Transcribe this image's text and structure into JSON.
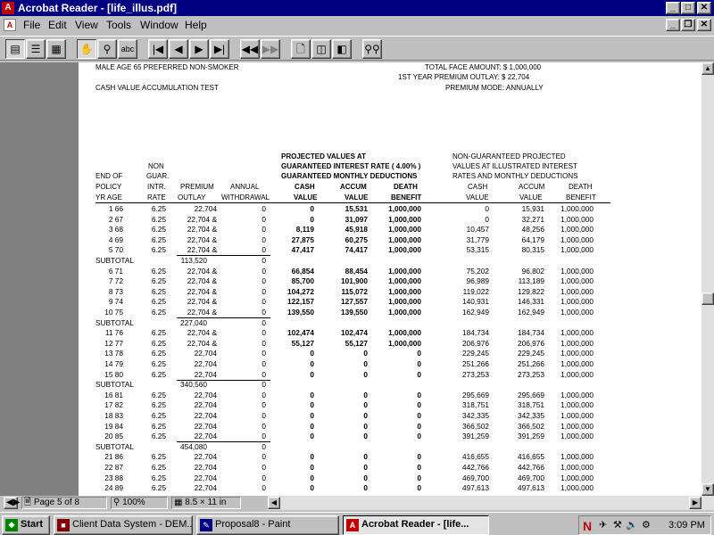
{
  "window": {
    "title": "Acrobat Reader - [life_illus.pdf]",
    "caption_buttons": [
      "_",
      "□",
      "✕"
    ]
  },
  "menu": [
    "File",
    "Edit",
    "View",
    "Tools",
    "Window",
    "Help"
  ],
  "toolbar_icons": [
    "page-only-icon",
    "bookmarks-icon",
    "thumbnails-icon",
    "hand-tool-icon",
    "zoom-tool-icon",
    "text-select-icon",
    "first-page-icon",
    "previous-page-icon",
    "next-page-icon",
    "last-page-icon",
    "go-back-icon",
    "go-forward-icon",
    "actual-size-icon",
    "fit-page-icon",
    "fit-width-icon",
    "find-icon"
  ],
  "document": {
    "header_left1": "MALE  AGE  65  PREFERRED  NON-SMOKER",
    "header_left2": "CASH VALUE ACCUMULATION TEST",
    "header_right1": "TOTAL FACE AMOUNT: $ 1,000,000",
    "header_right2": "1ST YEAR PREMIUM OUTLAY:  $ 22,704",
    "header_right3": "PREMIUM MODE: ANNUALLY",
    "guar_heading1": "PROJECTED VALUES AT",
    "guar_heading2": "GUARANTEED INTEREST RATE  ( 4.00% )",
    "guar_heading3": "GUARANTEED MONTHLY DEDUCTIONS",
    "nonguar_heading1": "NON-GUARANTEED PROJECTED",
    "nonguar_heading2": "VALUES AT ILLUSTRATED INTEREST",
    "nonguar_heading3": "RATES AND MONTHLY DEDUCTIONS",
    "col": {
      "end_of": "END OF",
      "policy": "POLICY",
      "yr_age": "YR  AGE",
      "non": "NON",
      "guar": "GUAR.",
      "intr": "INTR.",
      "rate": "RATE",
      "premium": "PREMIUM",
      "outlay": "OUTLAY",
      "annual": "ANNUAL",
      "withdrawal": "WITHDRAWAL",
      "cash": "CASH",
      "value": "VALUE",
      "accum": "ACCUM",
      "death": "DEATH",
      "benefit": "BENEFIT"
    },
    "rows": [
      {
        "k": "d",
        "yr": "1 66",
        "rate": "6.25",
        "prem": "22,704",
        "w": "0",
        "gc": "0",
        "ga": "15,531",
        "gd": "1,000,000",
        "nc": "0",
        "na": "15,931",
        "nd": "1,000,000"
      },
      {
        "k": "d",
        "yr": "2 67",
        "rate": "6.25",
        "prem": "22,704 &",
        "w": "0",
        "gc": "0",
        "ga": "31,097",
        "gd": "1,000,000",
        "nc": "0",
        "na": "32,271",
        "nd": "1,000,000"
      },
      {
        "k": "d",
        "yr": "3 68",
        "rate": "6.25",
        "prem": "22,704 &",
        "w": "0",
        "gc": "8,119",
        "ga": "45,918",
        "gd": "1,000,000",
        "nc": "10,457",
        "na": "48,256",
        "nd": "1,000,000"
      },
      {
        "k": "d",
        "yr": "4 69",
        "rate": "6.25",
        "prem": "22,704 &",
        "w": "0",
        "gc": "27,875",
        "ga": "60,275",
        "gd": "1,000,000",
        "nc": "31,779",
        "na": "64,179",
        "nd": "1,000,000"
      },
      {
        "k": "d",
        "yr": "5 70",
        "rate": "6.25",
        "prem": "22,704 &",
        "w": "0",
        "gc": "47,417",
        "ga": "74,417",
        "gd": "1,000,000",
        "nc": "53,315",
        "na": "80,315",
        "nd": "1,000,000",
        "ul": true
      },
      {
        "k": "s",
        "label": "SUBTOTAL",
        "prem": "113,520",
        "w": "0"
      },
      {
        "k": "d",
        "yr": "6 71",
        "rate": "6.25",
        "prem": "22,704 &",
        "w": "0",
        "gc": "66,854",
        "ga": "88,454",
        "gd": "1,000,000",
        "nc": "75,202",
        "na": "96,802",
        "nd": "1,000,000"
      },
      {
        "k": "d",
        "yr": "7 72",
        "rate": "6.25",
        "prem": "22,704 &",
        "w": "0",
        "gc": "85,700",
        "ga": "101,900",
        "gd": "1,000,000",
        "nc": "96,989",
        "na": "113,189",
        "nd": "1,000,000"
      },
      {
        "k": "d",
        "yr": "8 73",
        "rate": "6.25",
        "prem": "22,704 &",
        "w": "0",
        "gc": "104,272",
        "ga": "115,072",
        "gd": "1,000,000",
        "nc": "119,022",
        "na": "129,822",
        "nd": "1,000,000"
      },
      {
        "k": "d",
        "yr": "9 74",
        "rate": "6.25",
        "prem": "22,704 &",
        "w": "0",
        "gc": "122,157",
        "ga": "127,557",
        "gd": "1,000,000",
        "nc": "140,931",
        "na": "146,331",
        "nd": "1,000,000"
      },
      {
        "k": "d",
        "yr": "10 75",
        "rate": "6.25",
        "prem": "22,704 &",
        "w": "0",
        "gc": "139,550",
        "ga": "139,550",
        "gd": "1,000,000",
        "nc": "162,949",
        "na": "162,949",
        "nd": "1,000,000",
        "ul": true
      },
      {
        "k": "s",
        "label": "SUBTOTAL",
        "prem": "227,040",
        "w": "0"
      },
      {
        "k": "d",
        "yr": "11 76",
        "rate": "6.25",
        "prem": "22,704 &",
        "w": "0",
        "gc": "102,474",
        "ga": "102,474",
        "gd": "1,000,000",
        "nc": "184,734",
        "na": "184,734",
        "nd": "1,000,000"
      },
      {
        "k": "d",
        "yr": "12 77",
        "rate": "6.25",
        "prem": "22,704 &",
        "w": "0",
        "gc": "55,127",
        "ga": "55,127",
        "gd": "1,000,000",
        "nc": "206,976",
        "na": "206,976",
        "nd": "1,000,000"
      },
      {
        "k": "d",
        "yr": "13 78",
        "rate": "6.25",
        "prem": "22,704",
        "w": "0",
        "gc": "0",
        "ga": "0",
        "gd": "0",
        "nc": "229,245",
        "na": "229,245",
        "nd": "1,000,000"
      },
      {
        "k": "d",
        "yr": "14 79",
        "rate": "6.25",
        "prem": "22,704",
        "w": "0",
        "gc": "0",
        "ga": "0",
        "gd": "0",
        "nc": "251,266",
        "na": "251,266",
        "nd": "1,000,000"
      },
      {
        "k": "d",
        "yr": "15 80",
        "rate": "6.25",
        "prem": "22,704",
        "w": "0",
        "gc": "0",
        "ga": "0",
        "gd": "0",
        "nc": "273,253",
        "na": "273,253",
        "nd": "1,000,000",
        "ul": true
      },
      {
        "k": "s",
        "label": "SUBTOTAL",
        "prem": "340,560",
        "w": "0"
      },
      {
        "k": "d",
        "yr": "16 81",
        "rate": "6.25",
        "prem": "22,704",
        "w": "0",
        "gc": "0",
        "ga": "0",
        "gd": "0",
        "nc": "295,669",
        "na": "295,669",
        "nd": "1,000,000"
      },
      {
        "k": "d",
        "yr": "17 82",
        "rate": "6.25",
        "prem": "22,704",
        "w": "0",
        "gc": "0",
        "ga": "0",
        "gd": "0",
        "nc": "318,751",
        "na": "318,751",
        "nd": "1,000,000"
      },
      {
        "k": "d",
        "yr": "18 83",
        "rate": "6.25",
        "prem": "22,704",
        "w": "0",
        "gc": "0",
        "ga": "0",
        "gd": "0",
        "nc": "342,335",
        "na": "342,335",
        "nd": "1,000,000"
      },
      {
        "k": "d",
        "yr": "19 84",
        "rate": "6.25",
        "prem": "22,704",
        "w": "0",
        "gc": "0",
        "ga": "0",
        "gd": "0",
        "nc": "366,502",
        "na": "366,502",
        "nd": "1,000,000"
      },
      {
        "k": "d",
        "yr": "20 85",
        "rate": "6.25",
        "prem": "22,704",
        "w": "0",
        "gc": "0",
        "ga": "0",
        "gd": "0",
        "nc": "391,259",
        "na": "391,259",
        "nd": "1,000,000",
        "ul": true
      },
      {
        "k": "s",
        "label": "SUBTOTAL",
        "prem": "454,080",
        "w": "0"
      },
      {
        "k": "d",
        "yr": "21 86",
        "rate": "6.25",
        "prem": "22,704",
        "w": "0",
        "gc": "0",
        "ga": "0",
        "gd": "0",
        "nc": "416,655",
        "na": "416,655",
        "nd": "1,000,000"
      },
      {
        "k": "d",
        "yr": "22 87",
        "rate": "6.25",
        "prem": "22,704",
        "w": "0",
        "gc": "0",
        "ga": "0",
        "gd": "0",
        "nc": "442,766",
        "na": "442,766",
        "nd": "1,000,000"
      },
      {
        "k": "d",
        "yr": "23 88",
        "rate": "6.25",
        "prem": "22,704",
        "w": "0",
        "gc": "0",
        "ga": "0",
        "gd": "0",
        "nc": "469,700",
        "na": "469,700",
        "nd": "1,000,000"
      },
      {
        "k": "d",
        "yr": "24 89",
        "rate": "6.25",
        "prem": "22,704",
        "w": "0",
        "gc": "0",
        "ga": "0",
        "gd": "0",
        "nc": "497,613",
        "na": "497,613",
        "nd": "1,000,000"
      }
    ]
  },
  "status": {
    "page_label": "Page 5 of 8",
    "zoom": "100%",
    "page_size": "8.5 × 11 in"
  },
  "taskbar": {
    "start": "Start",
    "tasks": [
      {
        "label": "Client Data System - DEM...",
        "icon": "cds-icon",
        "active": false
      },
      {
        "label": "Proposal8 - Paint",
        "icon": "paint-icon",
        "active": false
      },
      {
        "label": "Acrobat Reader - [life...",
        "icon": "acrobat-icon",
        "active": true
      }
    ],
    "clock": "3:09 PM"
  },
  "colors": {
    "titlebar": "#000080",
    "face": "#c0c0c0",
    "doc_background": "#808080",
    "acrobat_red": "#c00000"
  }
}
